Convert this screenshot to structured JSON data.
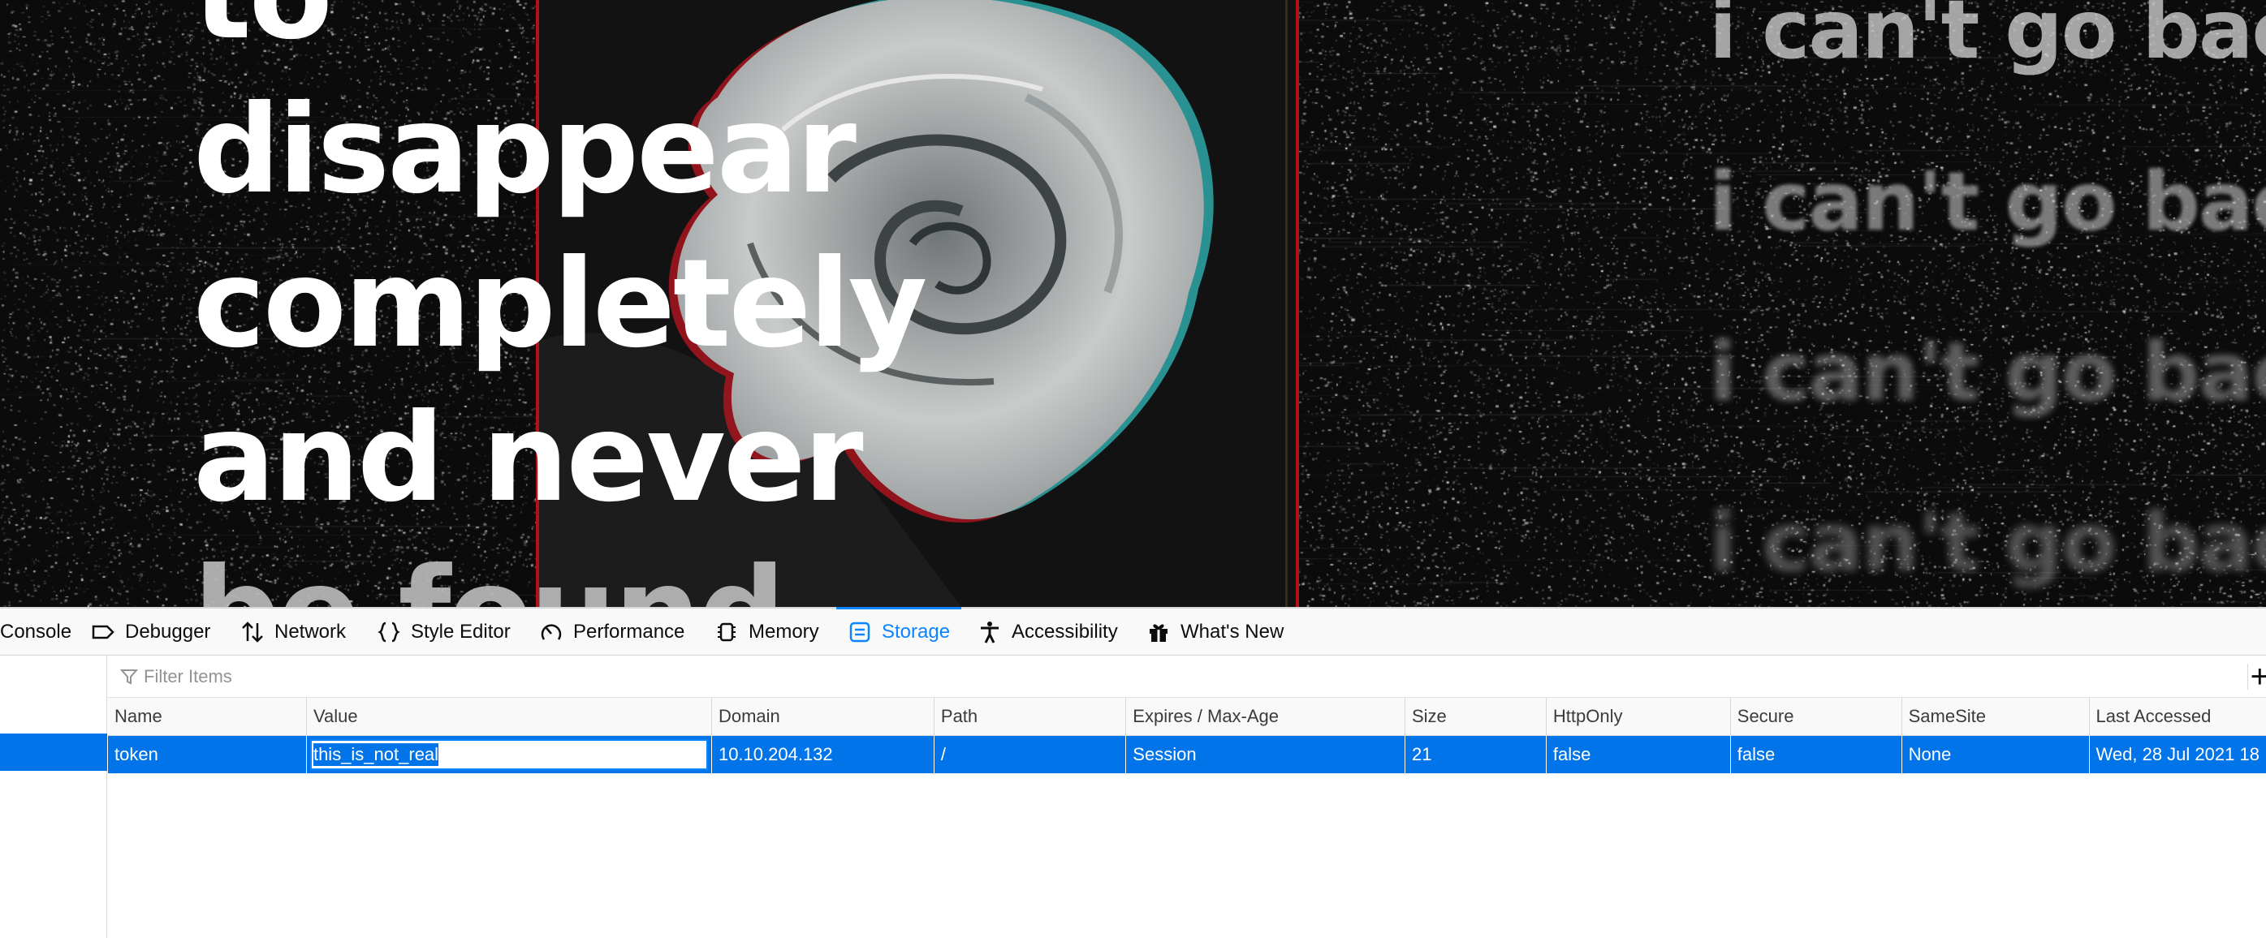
{
  "webpage": {
    "headline_lines": [
      "to",
      "disappear",
      "completely",
      "and never",
      "be found"
    ],
    "echo_text": "i can't go back to"
  },
  "devtools": {
    "tabs": [
      {
        "label": "Console",
        "icon": "console-icon"
      },
      {
        "label": "Debugger",
        "icon": "debugger-icon"
      },
      {
        "label": "Network",
        "icon": "network-icon"
      },
      {
        "label": "Style Editor",
        "icon": "braces-icon"
      },
      {
        "label": "Performance",
        "icon": "gauge-icon"
      },
      {
        "label": "Memory",
        "icon": "chip-icon"
      },
      {
        "label": "Storage",
        "icon": "storage-icon",
        "active": true
      },
      {
        "label": "Accessibility",
        "icon": "accessibility-icon"
      },
      {
        "label": "What's New",
        "icon": "gift-icon"
      }
    ],
    "filter": {
      "placeholder": "Filter Items"
    },
    "columns": [
      "Name",
      "Value",
      "Domain",
      "Path",
      "Expires / Max-Age",
      "Size",
      "HttpOnly",
      "Secure",
      "SameSite",
      "Last Accessed"
    ],
    "rows": [
      {
        "name": "token",
        "value": "this_is_not_real",
        "domain": "10.10.204.132",
        "path": "/",
        "expires": "Session",
        "size": "21",
        "httponly": "false",
        "secure": "false",
        "samesite": "None",
        "last_accessed": "Wed, 28 Jul 2021 18"
      }
    ],
    "accent_color": "#0a84ff",
    "selection_color": "#0074e8"
  }
}
